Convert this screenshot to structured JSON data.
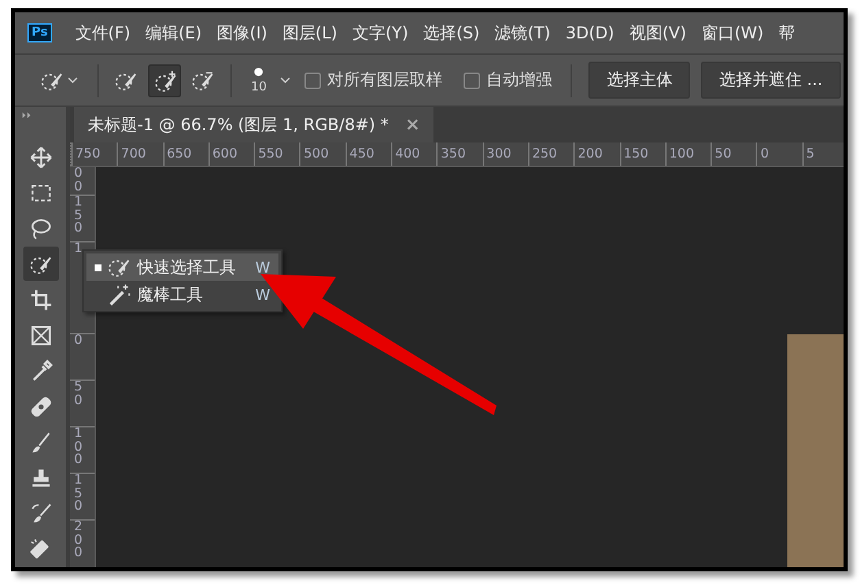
{
  "menu_bar": {
    "logo": "Ps",
    "items": [
      "文件(F)",
      "编辑(E)",
      "图像(I)",
      "图层(L)",
      "文字(Y)",
      "选择(S)",
      "滤镜(T)",
      "3D(D)",
      "视图(V)",
      "窗口(W)",
      "帮"
    ]
  },
  "options_bar": {
    "modes": [
      {
        "kind": "new",
        "selected": false
      },
      {
        "kind": "add",
        "selected": true
      },
      {
        "kind": "subtract",
        "selected": false
      }
    ],
    "brush_size": "10",
    "checkboxes": [
      {
        "label": "对所有图层取样",
        "checked": false
      },
      {
        "label": "自动增强",
        "checked": false
      }
    ],
    "buttons": [
      "选择主体",
      "选择并遮住 ..."
    ]
  },
  "document_tab": {
    "title": "未标题-1 @ 66.7% (图层 1, RGB/8#) *",
    "close": "×"
  },
  "toolbar": {
    "tools": [
      {
        "kind": "move",
        "selected": false
      },
      {
        "kind": "marquee",
        "selected": false
      },
      {
        "kind": "lasso",
        "selected": false
      },
      {
        "kind": "quick-selection",
        "selected": true
      },
      {
        "kind": "crop",
        "selected": false
      },
      {
        "kind": "frame",
        "selected": false
      },
      {
        "kind": "eyedropper",
        "selected": false
      },
      {
        "kind": "healing",
        "selected": false
      },
      {
        "kind": "brush",
        "selected": false
      },
      {
        "kind": "stamp",
        "selected": false
      },
      {
        "kind": "history-brush",
        "selected": false
      },
      {
        "kind": "eraser",
        "selected": false
      }
    ]
  },
  "rulers": {
    "horizontal": [
      "750",
      "700",
      "650",
      "600",
      "550",
      "500",
      "450",
      "400",
      "350",
      "300",
      "250",
      "200",
      "150",
      "100",
      "50",
      "0",
      "5"
    ],
    "vertical": [
      "00",
      "150",
      "1",
      "0",
      "50",
      "100",
      "150",
      "200"
    ]
  },
  "flyout_menu": {
    "items": [
      {
        "kind": "quick-selection",
        "label": "快速选择工具",
        "shortcut": "W",
        "selected": true
      },
      {
        "kind": "magic-wand",
        "label": "魔棒工具",
        "shortcut": "W",
        "selected": false
      }
    ]
  }
}
